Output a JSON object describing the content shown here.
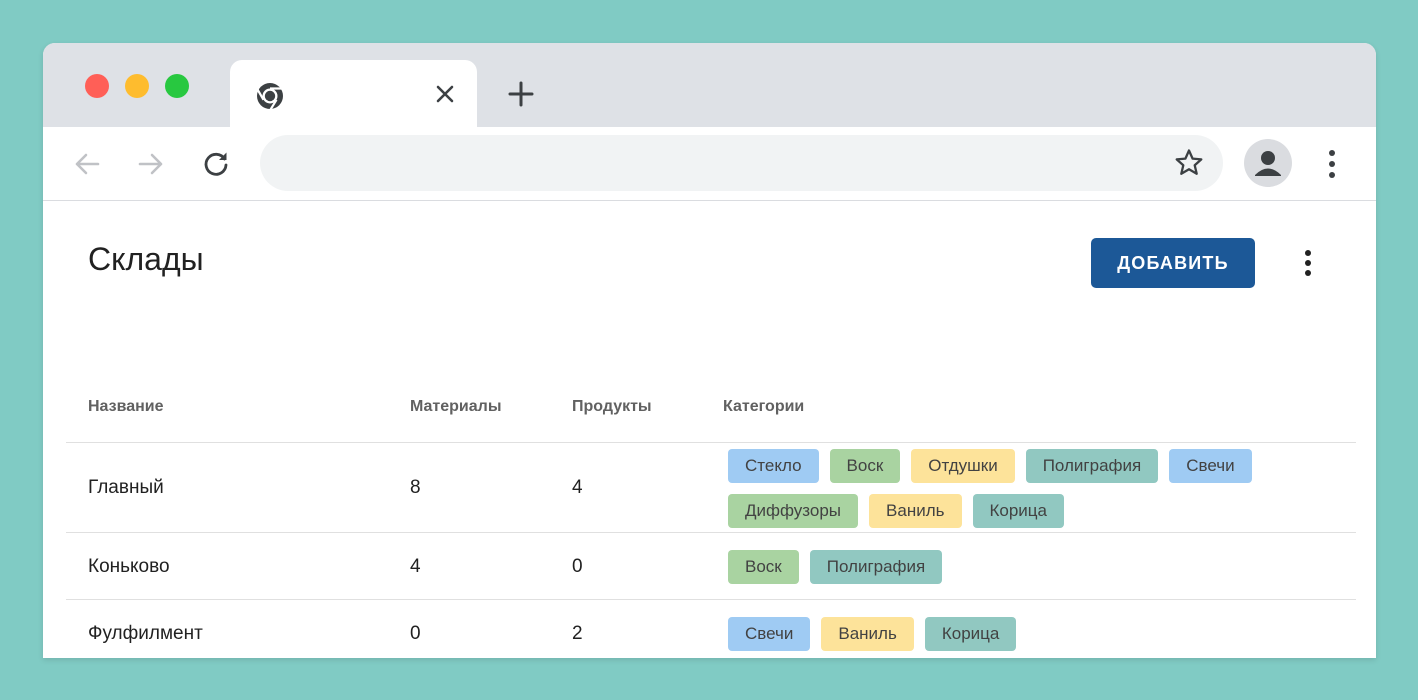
{
  "browser": {
    "tab_title": "",
    "address_value": "",
    "address_placeholder": ""
  },
  "page": {
    "title": "Склады",
    "add_button_label": "ДОБАВИТЬ"
  },
  "colors": {
    "accent": "#1c5897",
    "background": "#80cbc4",
    "chip_blue": "#9fcbf3",
    "chip_green": "#a9d3a1",
    "chip_yellow": "#fde39a",
    "chip_teal": "#91c8c1"
  },
  "table": {
    "headers": {
      "name": "Название",
      "materials": "Материалы",
      "products": "Продукты",
      "categories": "Категории"
    },
    "rows": [
      {
        "name": "Главный",
        "materials": "8",
        "products": "4",
        "categories": [
          {
            "label": "Стекло",
            "color": "blue"
          },
          {
            "label": "Воск",
            "color": "green"
          },
          {
            "label": "Отдушки",
            "color": "yellow"
          },
          {
            "label": "Полиграфия",
            "color": "teal"
          },
          {
            "label": "Свечи",
            "color": "blue"
          },
          {
            "label": "Диффузоры",
            "color": "green"
          },
          {
            "label": "Ваниль",
            "color": "yellow"
          },
          {
            "label": "Корица",
            "color": "teal"
          }
        ]
      },
      {
        "name": "Коньково",
        "materials": "4",
        "products": "0",
        "categories": [
          {
            "label": "Воск",
            "color": "green"
          },
          {
            "label": "Полиграфия",
            "color": "teal"
          }
        ]
      },
      {
        "name": "Фулфилмент",
        "materials": "0",
        "products": "2",
        "categories": [
          {
            "label": "Свечи",
            "color": "blue"
          },
          {
            "label": "Ваниль",
            "color": "yellow"
          },
          {
            "label": "Корица",
            "color": "teal"
          }
        ]
      }
    ]
  },
  "icons": {
    "tab": "chrome-icon",
    "close": "close-icon",
    "new_tab": "plus-icon",
    "back": "arrow-back-icon",
    "forward": "arrow-forward-icon",
    "reload": "reload-icon",
    "bookmark": "star-icon",
    "profile": "avatar-icon",
    "menu": "more-vert-icon"
  }
}
